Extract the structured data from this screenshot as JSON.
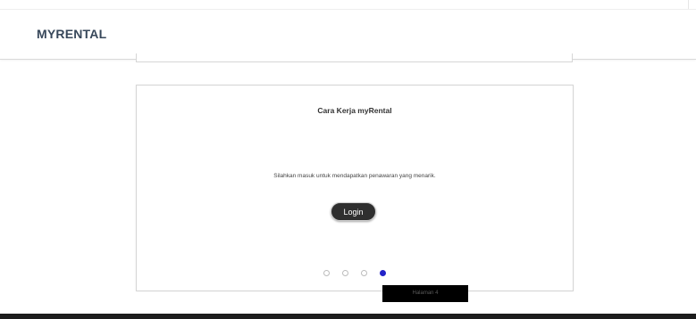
{
  "header": {
    "brand": "MYRENTAL"
  },
  "card": {
    "title": "Cara Kerja myRental",
    "text": "Silahkan masuk untuk mendapatkan penawaran yang menarik.",
    "login_label": "Login"
  },
  "pagination": {
    "total": 4,
    "active_index": 4,
    "tooltip": "Halaman 4"
  },
  "colors": {
    "brand": "#37475a",
    "active_dot": "#2323c8",
    "button_bg": "#2f2f2f",
    "footer": "#1c1c1c"
  }
}
